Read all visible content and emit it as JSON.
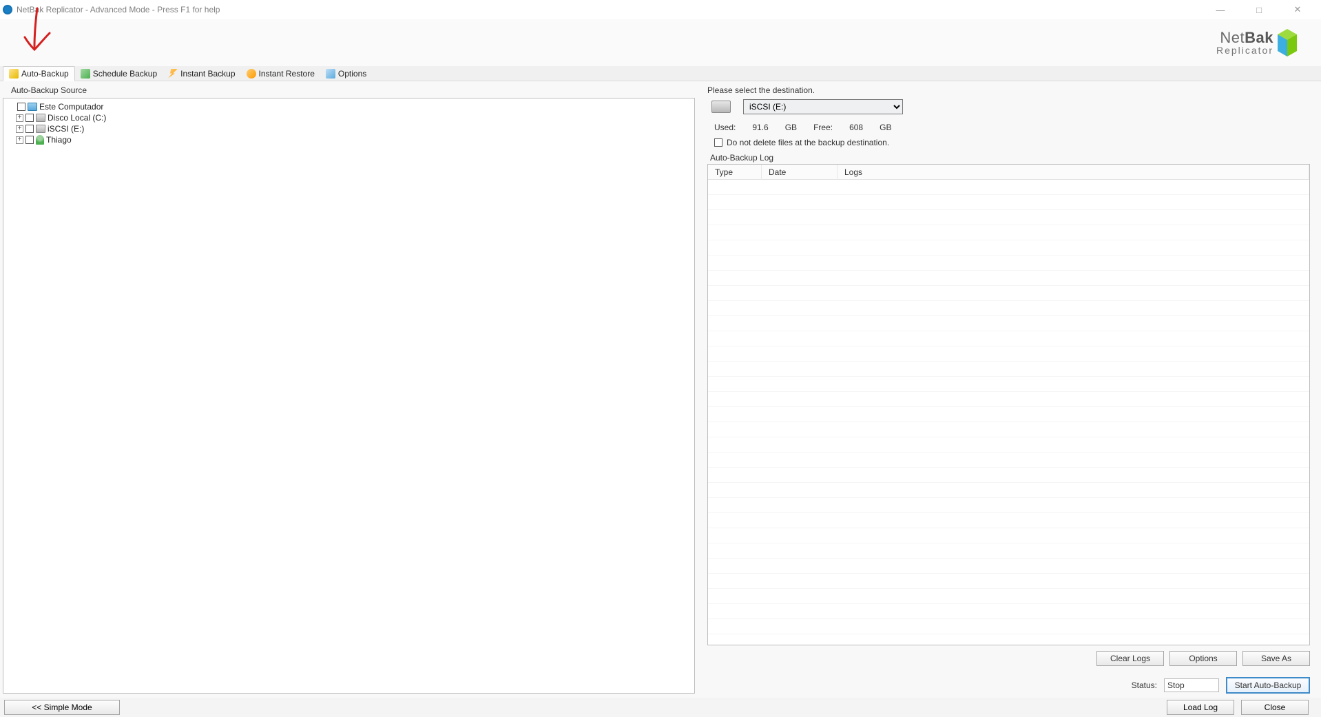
{
  "window": {
    "title": "NetBak Replicator - Advanced Mode - Press F1 for help"
  },
  "brand": {
    "line1_a": "Net",
    "line1_b": "Bak",
    "line2": "Replicator"
  },
  "toolbar": {
    "auto_backup": "Auto-Backup",
    "schedule_backup": "Schedule Backup",
    "instant_backup": "Instant Backup",
    "instant_restore": "Instant Restore",
    "options": "Options"
  },
  "left_panel": {
    "title": "Auto-Backup Source",
    "tree": {
      "root": "Este Computador",
      "children": [
        {
          "label": "Disco Local (C:)",
          "icon": "disk"
        },
        {
          "label": "iSCSI (E:)",
          "icon": "disk"
        },
        {
          "label": "Thiago",
          "icon": "user"
        }
      ]
    }
  },
  "right_panel": {
    "prompt": "Please select the destination.",
    "selected_destination": "iSCSI (E:)",
    "storage": {
      "used_label": "Used:",
      "used_value": "91.6",
      "used_unit": "GB",
      "free_label": "Free:",
      "free_value": "608",
      "free_unit": "GB"
    },
    "no_delete_label": "Do not delete files at the backup destination.",
    "log_title": "Auto-Backup Log",
    "log_columns": {
      "type": "Type",
      "date": "Date",
      "logs": "Logs"
    },
    "buttons": {
      "clear_logs": "Clear Logs",
      "options": "Options",
      "save_as": "Save As"
    },
    "status_label": "Status:",
    "status_value": "Stop",
    "start_button": "Start Auto-Backup"
  },
  "footer": {
    "simple_mode": "<<  Simple Mode",
    "load_log": "Load Log",
    "close": "Close"
  }
}
